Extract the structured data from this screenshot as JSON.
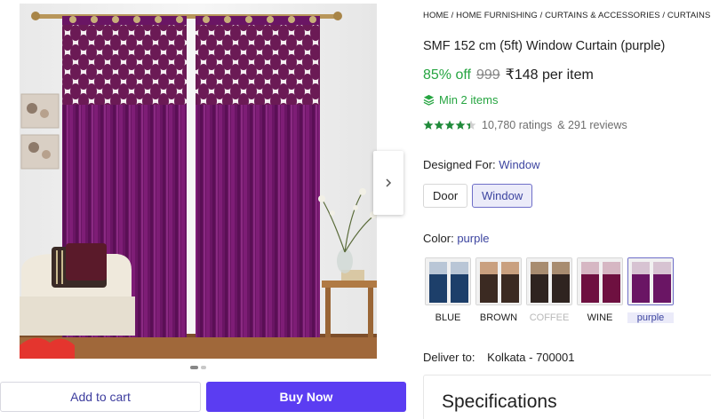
{
  "breadcrumb": "HOME / HOME FURNISHING / CURTAINS & ACCESSORIES / CURTAINS / SMF CURT",
  "product": {
    "title": "SMF 152 cm (5ft) Window Curtain (purple)",
    "discount": "85% off",
    "mrp": "999",
    "price": "₹148 per item",
    "min_qty": "Min 2 items",
    "ratings": "10,780 ratings",
    "reviews": "& 291 reviews",
    "stars": 4.2
  },
  "designed_for": {
    "label": "Designed For:",
    "selected": "Window",
    "options": [
      "Door",
      "Window"
    ]
  },
  "color": {
    "label": "Color:",
    "selected": "purple",
    "options": [
      "BLUE",
      "BROWN",
      "COFFEE",
      "WINE",
      "purple"
    ]
  },
  "delivery": {
    "label": "Deliver to:",
    "location": "Kolkata - 700001"
  },
  "actions": {
    "add_to_cart": "Add to cart",
    "buy_now": "Buy Now"
  },
  "specifications": {
    "title": "Specifications"
  },
  "gallery": {
    "active_index": 0,
    "count": 2
  },
  "colors": {
    "accent": "#5b3df2",
    "discount_green": "#26a541",
    "link_blue": "#3d45a0",
    "curtain_purple": "#6e1566"
  }
}
